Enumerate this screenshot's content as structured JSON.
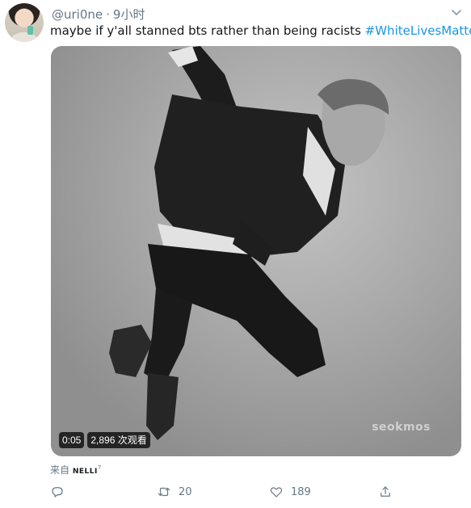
{
  "user": {
    "handle": "@uri0ne",
    "separator": "·",
    "time": "9小时"
  },
  "tweet": {
    "text": "maybe if y'all stanned bts rather than being racists ",
    "hashtag": "#WhiteLivesMatter"
  },
  "media": {
    "watermark": "seokmos",
    "duration": "0:05",
    "views": "2,896 次观看"
  },
  "source": {
    "prefix": "来自",
    "app": "NELLI",
    "app_sup": "7"
  },
  "actions": {
    "reply_count": "",
    "retweet_count": "20",
    "like_count": "189"
  },
  "colors": {
    "link": "#1b95e0",
    "secondary": "#657786",
    "text": "#14171a"
  },
  "icons": [
    "caret-down-icon",
    "reply-icon",
    "retweet-icon",
    "like-icon",
    "share-icon"
  ]
}
